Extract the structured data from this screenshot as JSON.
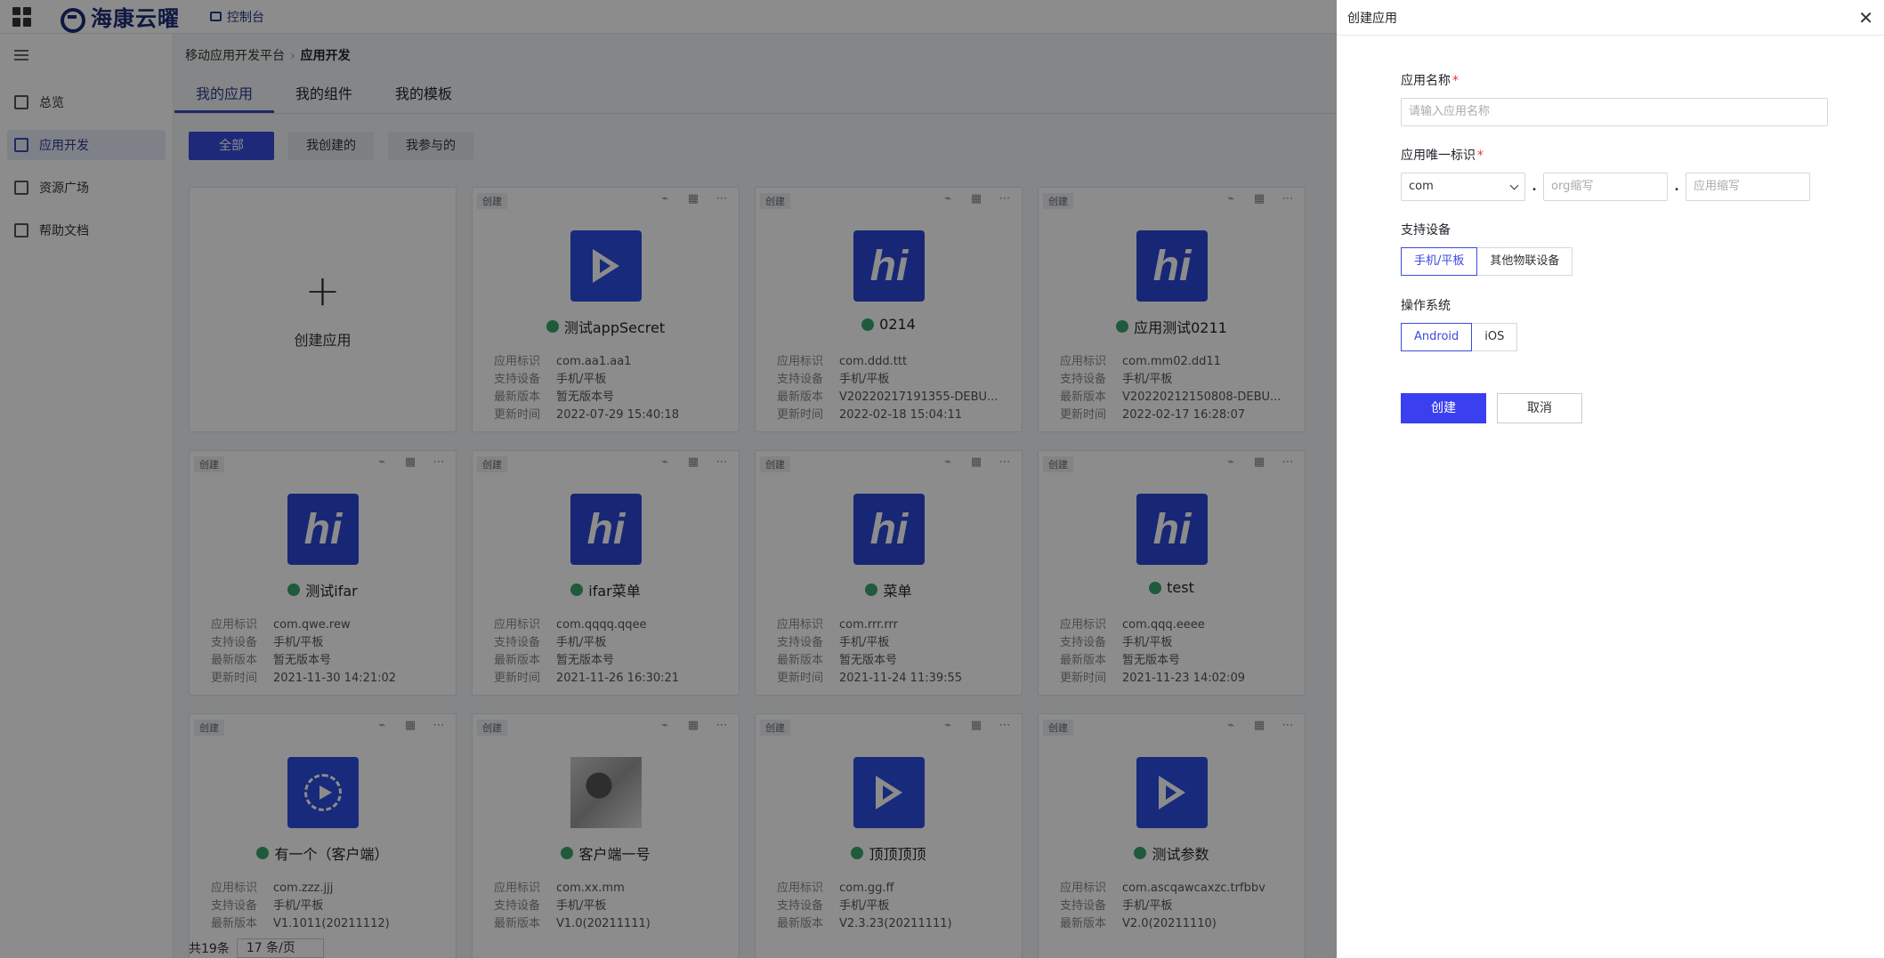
{
  "header": {
    "brand": "海康云曜",
    "console_label": "控制台"
  },
  "sidebar": {
    "items": [
      {
        "label": "总览"
      },
      {
        "label": "应用开发"
      },
      {
        "label": "资源广场"
      },
      {
        "label": "帮助文档"
      }
    ]
  },
  "breadcrumb": {
    "parent": "移动应用开发平台",
    "current": "应用开发"
  },
  "tabs": [
    {
      "label": "我的应用"
    },
    {
      "label": "我的组件"
    },
    {
      "label": "我的模板"
    }
  ],
  "filters": [
    {
      "label": "全部"
    },
    {
      "label": "我创建的"
    },
    {
      "label": "我参与的"
    }
  ],
  "create_card": {
    "label": "创建应用"
  },
  "meta_labels": {
    "id": "应用标识",
    "device": "支持设备",
    "version": "最新版本",
    "updated": "更新时间"
  },
  "badge_label": "创建",
  "apps": [
    {
      "name": "测试appSecret",
      "id": "com.aa1.aa1",
      "device": "手机/平板",
      "version": "暂无版本号",
      "updated": "2022-07-29 15:40:18",
      "icon": "play"
    },
    {
      "name": "0214",
      "id": "com.ddd.ttt",
      "device": "手机/平板",
      "version": "V20220217191355-DEBU...",
      "updated": "2022-02-18 15:04:11",
      "icon": "hi"
    },
    {
      "name": "应用测试0211",
      "id": "com.mm02.dd11",
      "device": "手机/平板",
      "version": "V20220212150808-DEBU...",
      "updated": "2022-02-17 16:28:07",
      "icon": "hi"
    },
    {
      "name": "测试ifar",
      "id": "com.qwe.rew",
      "device": "手机/平板",
      "version": "暂无版本号",
      "updated": "2021-11-30 14:21:02",
      "icon": "hi"
    },
    {
      "name": "ifar菜单",
      "id": "com.qqqq.qqee",
      "device": "手机/平板",
      "version": "暂无版本号",
      "updated": "2021-11-26 16:30:21",
      "icon": "hi"
    },
    {
      "name": "菜单",
      "id": "com.rrr.rrr",
      "device": "手机/平板",
      "version": "暂无版本号",
      "updated": "2021-11-24 11:39:55",
      "icon": "hi"
    },
    {
      "name": "test",
      "id": "com.qqq.eeee",
      "device": "手机/平板",
      "version": "暂无版本号",
      "updated": "2021-11-23 14:02:09",
      "icon": "hi"
    },
    {
      "name": "有一个（客户端）",
      "id": "com.zzz.jjj",
      "device": "手机/平板",
      "version": "V1.1011(20211112)",
      "updated": "",
      "icon": "circle"
    },
    {
      "name": "客户端一号",
      "id": "com.xx.mm",
      "device": "手机/平板",
      "version": "V1.0(20211111)",
      "updated": "",
      "icon": "art"
    },
    {
      "name": "顶顶顶顶",
      "id": "com.gg.ff",
      "device": "手机/平板",
      "version": "V2.3.23(20211111)",
      "updated": "",
      "icon": "play"
    },
    {
      "name": "测试参数",
      "id": "com.ascqawcaxzc.trfbbv",
      "device": "手机/平板",
      "version": "V2.0(20211110)",
      "updated": "",
      "icon": "play"
    }
  ],
  "pager": {
    "total": "共19条",
    "page_size": "17 条/页"
  },
  "drawer": {
    "title": "创建应用",
    "name_label": "应用名称",
    "name_placeholder": "请输入应用名称",
    "id_label": "应用唯一标识",
    "id_prefix": "com",
    "org_placeholder": "org缩写",
    "app_placeholder": "应用缩写",
    "device_label": "支持设备",
    "device_options": [
      "手机/平板",
      "其他物联设备"
    ],
    "os_label": "操作系统",
    "os_options": [
      "Android",
      "iOS"
    ],
    "create_button": "创建",
    "cancel_button": "取消"
  }
}
